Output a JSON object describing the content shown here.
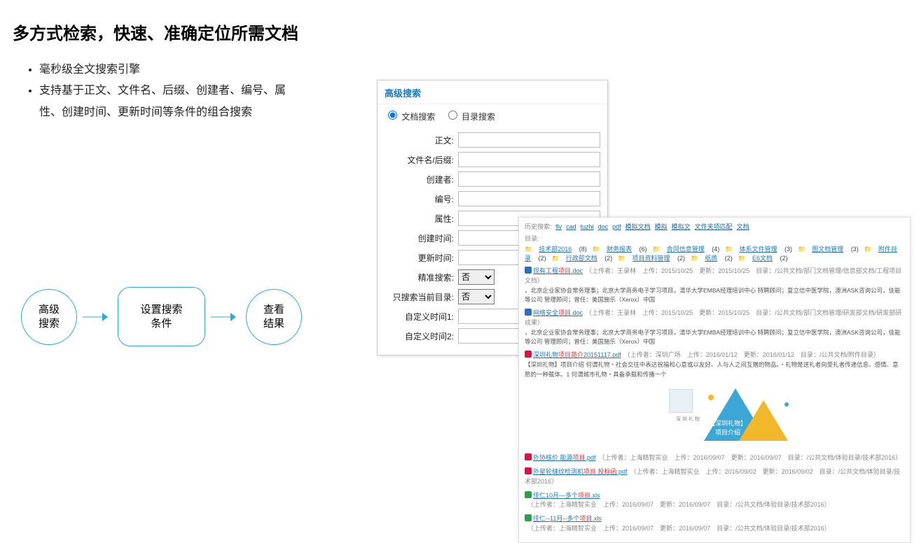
{
  "title": "多方式检索，快速、准确定位所需文档",
  "bullets": [
    "毫秒级全文搜索引擎",
    "支持基于正文、文件名、后缀、创建者、编号、属性、创建时间、更新时间等条件的组合搜索"
  ],
  "flow": {
    "step1": "高级\n搜索",
    "step2": "设置搜索\n条件",
    "step3": "查看\n结果"
  },
  "adv": {
    "header": "高级搜索",
    "radio_doc": "文档搜索",
    "radio_dir": "目录搜索",
    "labels": {
      "zhengwen": "正文:",
      "filename": "文件名/后缀:",
      "creator": "创建者:",
      "bianhao": "编号:",
      "shuxing": "属性:",
      "ctime": "创建时间:",
      "utime": "更新时间:",
      "jingzhun": "精准搜索:",
      "curdir": "只搜索当前目录:",
      "zdy1": "自定义时间1:",
      "zdy2": "自定义时间2:"
    },
    "opt_no": "否"
  },
  "results": {
    "history_label": "历史搜索:",
    "history": [
      "flv",
      "cad",
      "tuzhi",
      "doc",
      "pdf",
      "模拟文档",
      "模拟",
      "模拟文",
      "文件夹项匹配",
      "文档"
    ],
    "catalog_label": "目录:",
    "categories": [
      {
        "name": "技术部2016",
        "count": "(8)"
      },
      {
        "name": "财务报表",
        "count": "(6)"
      },
      {
        "name": "合同信息管理",
        "count": "(4)"
      },
      {
        "name": "体系文件管理",
        "count": "(3)"
      },
      {
        "name": "图文档管理",
        "count": "(3)"
      },
      {
        "name": "附件目录",
        "count": "(2)"
      },
      {
        "name": "行政部文档",
        "count": "(2)"
      },
      {
        "name": "项目资料管理",
        "count": "(2)"
      },
      {
        "name": "纸质",
        "count": "(2)"
      },
      {
        "name": "E6文档",
        "count": "(2)"
      }
    ],
    "items": [
      {
        "ext": "doc",
        "title_pre": "现有工程",
        "title_hl": "项目",
        "title_post": ".doc",
        "meta": "（上传者：王录林　上传：2015/10/25　更新：2015/10/25　目录：/公共文档/部门文档管理/信息部文档/工程项目文档）",
        "desc": "，北京企业家协会常务理事；北京大学商务电子学习项目，清华大学EMBA经理培训中心 特聘顾问；复立信中医学院，澳洲ASK咨询公司，佳能等公司 管理顾问；曾任：美国施乐（Xerox）中国"
      },
      {
        "ext": "doc",
        "title_pre": "网络安全",
        "title_hl": "项目",
        "title_post": ".doc",
        "meta": "（上传者：王录林　上传：2015/10/25　更新：2015/10/25　目录：/公共文档/部门文档管理/研发部文档/研发部研成果）",
        "desc": "，北京企业家协会常务理事；北京大学商务电子学习项目，清华大学EMBA经理培训中心 特聘顾问；复立信中医学院，澳洲ASK咨询公司，佳能等公司 管理顾问；曾任：美国施乐（Xerox）中国"
      },
      {
        "ext": "pdf",
        "title_pre": "深圳礼物",
        "title_hl": "项目简介",
        "title_post": "20151117.pdf",
        "meta": "（上传者：深圳广场　上传：2016/01/12　更新：2016/01/12　目录：/公共文档/附件目录）",
        "desc": "【深圳礼物】项目介绍 何谓礼物・社会交往中表达祝福和心意或以友好、人与人之间互赠的物品。・礼物是送礼者向受礼者传递信息、感情、意愿的一种载体。1 何谓城市礼物・具备承载和传播一个"
      }
    ],
    "preview_caption": "【深圳礼物】\n项目介绍",
    "extra_items": [
      {
        "ext": "pdf",
        "title_pre": "外协核价 能源",
        "title_hl": "项目",
        "title_post": ".pdf",
        "meta": "（上传者：上海精智实业　上传：2016/09/07　更新：2016/09/07　目录：/公共文档/体验目录/技术部2016）"
      },
      {
        "ext": "pdf",
        "title_pre": "外星轮缝纹检测机",
        "title_hl": "项目 投标函",
        "title_post": ".pdf",
        "meta": "（上传者：上海精智实业　上传：2016/09/02　更新：2016/09/02　目录：/公共文档/体验目录/技术部2016）"
      },
      {
        "ext": "xls",
        "title_pre": "佳仁10月---多个",
        "title_hl": "项目",
        "title_post": ".xls",
        "meta": "（上传者：上海精智实业　上传：2016/09/07　更新：2016/09/07　目录：/公共文档/体验目录/技术部2016）"
      },
      {
        "ext": "xls",
        "title_pre": "佳仁--11月--多个",
        "title_hl": "项目",
        "title_post": ".xls",
        "meta": "（上传者：上海精智实业　上传：2016/09/07　更新：2016/09/07　目录：/公共文档/体验目录/技术部2016）"
      }
    ]
  }
}
